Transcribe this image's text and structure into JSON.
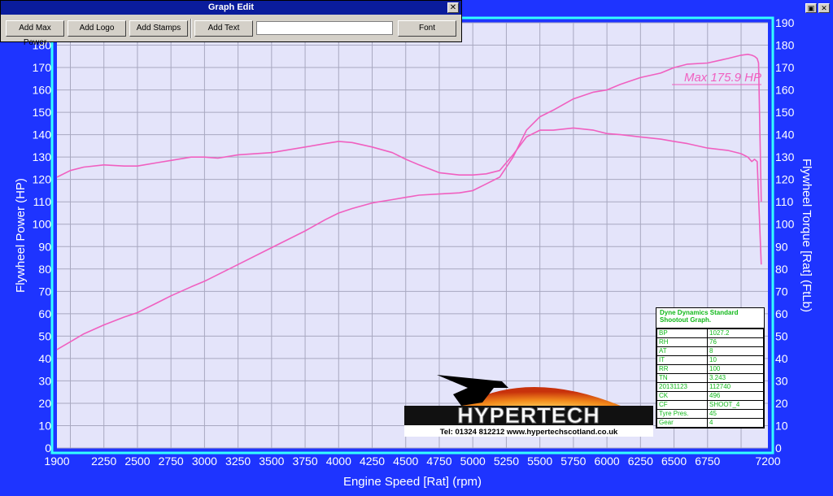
{
  "window_controls": {
    "restore": "▣",
    "close": "✕"
  },
  "graph_edit": {
    "title": "Graph Edit",
    "close": "✕",
    "buttons": {
      "add_max_power": "Add Max Power",
      "add_logo": "Add Logo",
      "add_stamps": "Add Stamps",
      "add_text": "Add Text",
      "font": "Font"
    },
    "text_value": ""
  },
  "annotation": "Max 175.9 HP",
  "info_table": {
    "title_line1": "Dyne Dynamics Standard",
    "title_line2": "Shootout Graph.",
    "rows": [
      {
        "k": "BP",
        "v": "1027.2"
      },
      {
        "k": "RH",
        "v": "76"
      },
      {
        "k": "AT",
        "v": "8"
      },
      {
        "k": "IT",
        "v": "10"
      },
      {
        "k": "RR",
        "v": "100"
      },
      {
        "k": "TN",
        "v": "3.243"
      },
      {
        "k": "20131123",
        "v": "112740"
      },
      {
        "k": "CK",
        "v": "496"
      },
      {
        "k": "CF",
        "v": "SHOOT_4"
      },
      {
        "k": "Tyre Pres.",
        "v": "45"
      },
      {
        "k": "Gear",
        "v": "4"
      }
    ]
  },
  "logo": {
    "name": "HYPERTECH",
    "contact": "Tel: 01324 812212   www.hypertechscotland.co.uk"
  },
  "chart_data": {
    "type": "line",
    "xlabel": "Engine Speed [Rat] (rpm)",
    "ylabel": "Flywheel Power (HP)",
    "y2label": "Flywheel Torque [Rat] (FtLb)",
    "xlim": [
      1900,
      7200
    ],
    "ylim": [
      0,
      190
    ],
    "y2lim": [
      0,
      190
    ],
    "x_ticks": [
      1900,
      2250,
      2500,
      2750,
      3000,
      3250,
      3500,
      3750,
      4000,
      4250,
      4500,
      4750,
      5000,
      5250,
      5500,
      5750,
      6000,
      6250,
      6500,
      6750,
      7200
    ],
    "y_ticks": [
      0,
      10,
      20,
      30,
      40,
      50,
      60,
      70,
      80,
      90,
      100,
      110,
      120,
      130,
      140,
      150,
      160,
      170,
      180
    ],
    "y2_ticks": [
      0,
      10,
      20,
      30,
      40,
      50,
      60,
      70,
      80,
      90,
      100,
      110,
      120,
      130,
      140,
      150,
      160,
      170,
      180,
      190
    ],
    "grid": true,
    "colors": {
      "plot_bg": "#e4e4fa",
      "frame": "#33ffff",
      "grid": "#a8a8c0",
      "series": "#f060c0",
      "background": "#1e34ff"
    },
    "series": [
      {
        "axis": "left",
        "x": [
          1900,
          2000,
          2100,
          2250,
          2400,
          2500,
          2650,
          2750,
          2900,
          3000,
          3250,
          3500,
          3750,
          3900,
          4000,
          4100,
          4250,
          4400,
          4500,
          4600,
          4750,
          4900,
          5000,
          5100,
          5200,
          5300,
          5400,
          5500,
          5600,
          5750,
          5900,
          6000,
          6100,
          6250,
          6400,
          6500,
          6600,
          6750,
          6900,
          7000,
          7050,
          7080,
          7100,
          7120,
          7130,
          7150
        ],
        "y": [
          44,
          47.5,
          51,
          55,
          58.5,
          60.5,
          65,
          68,
          72,
          74.5,
          82,
          89.5,
          97,
          102,
          105,
          107,
          109.5,
          111,
          112,
          113,
          113.5,
          114,
          115,
          118,
          121,
          130,
          142,
          148,
          151,
          156,
          159,
          160,
          162.5,
          165.5,
          167.5,
          170,
          171.5,
          172,
          174,
          175.5,
          175.9,
          175.5,
          175,
          174,
          172,
          110
        ]
      },
      {
        "axis": "right",
        "x": [
          1900,
          2000,
          2100,
          2250,
          2400,
          2500,
          2650,
          2750,
          2900,
          3000,
          3100,
          3250,
          3500,
          3750,
          3900,
          4000,
          4100,
          4250,
          4400,
          4500,
          4600,
          4750,
          4900,
          5000,
          5100,
          5200,
          5300,
          5400,
          5500,
          5600,
          5750,
          5900,
          6000,
          6100,
          6250,
          6400,
          6500,
          6600,
          6750,
          6900,
          7000,
          7050,
          7080,
          7100,
          7120,
          7150
        ],
        "y": [
          121,
          124,
          125.5,
          126.5,
          126,
          126,
          127.5,
          128.5,
          130,
          130,
          129.5,
          131,
          132,
          134.5,
          136,
          137,
          136.5,
          134.5,
          132,
          129,
          126.5,
          123,
          122,
          122,
          122.5,
          124,
          131,
          139,
          142,
          142,
          143,
          142,
          140.5,
          140,
          139,
          138,
          137,
          136,
          134,
          133,
          131.5,
          130,
          128,
          129,
          128,
          82
        ]
      }
    ]
  }
}
